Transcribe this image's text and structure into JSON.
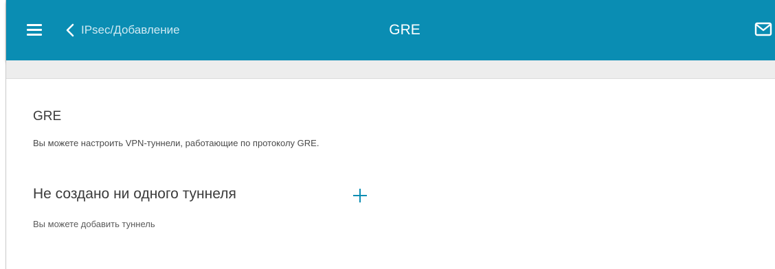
{
  "header": {
    "back_label": "IPsec/Добавление",
    "title": "GRE",
    "icons": {
      "menu": "hamburger-menu-icon",
      "back": "chevron-left-icon",
      "notifications": "mail-icon"
    },
    "colors": {
      "bar": "#0a8db3",
      "text": "#ffffff"
    }
  },
  "main": {
    "section_title": "GRE",
    "section_description": "Вы можете настроить VPN-туннели, работающие по протоколу GRE.",
    "empty_state": {
      "title": "Не создано ни одного туннеля",
      "add_icon": "plus-icon",
      "description": "Вы можете добавить туннель"
    }
  }
}
